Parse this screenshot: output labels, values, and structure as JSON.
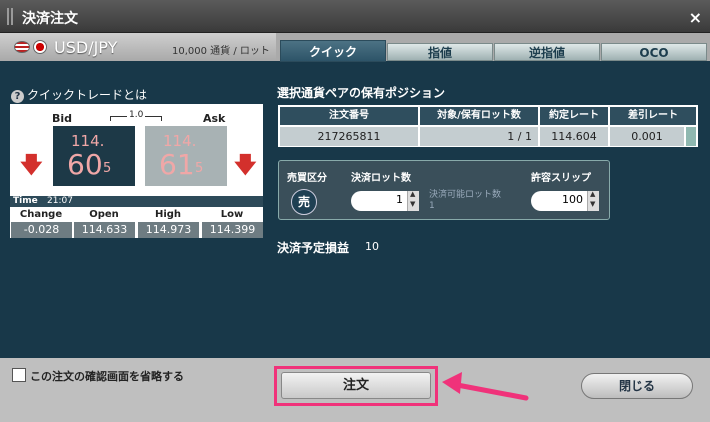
{
  "window": {
    "title": "決済注文",
    "close_glyph": "×"
  },
  "currency": {
    "pair": "USD/JPY",
    "unit": "10,000 通貨 / ロット"
  },
  "tabs": [
    {
      "label": "クイック",
      "active": true
    },
    {
      "label": "指値",
      "active": false
    },
    {
      "label": "逆指値",
      "active": false
    },
    {
      "label": "OCO",
      "active": false
    }
  ],
  "quick": {
    "help_label": "クイックトレードとは",
    "bid_label": "Bid",
    "ask_label": "Ask",
    "spread": "1.0",
    "bid": {
      "int": "114.",
      "big": "60",
      "small": "5"
    },
    "ask": {
      "int": "114.",
      "big": "61",
      "small": "5"
    },
    "time_label": "Time",
    "time_value": "21:07",
    "stats": {
      "headers": [
        "Change",
        "Open",
        "High",
        "Low"
      ],
      "values": [
        "-0.028",
        "114.633",
        "114.973",
        "114.399"
      ]
    }
  },
  "positions": {
    "title": "選択通貨ペアの保有ポジション",
    "headers": [
      "注文番号",
      "対象/保有ロット数",
      "約定レート",
      "差引レート"
    ],
    "row": [
      "217265811",
      "1 / 1",
      "114.604",
      "0.001"
    ]
  },
  "order": {
    "side_label": "売買区分",
    "side_value": "売",
    "lot_label": "決済ロット数",
    "lot_value": "1",
    "available_label": "決済可能ロット数",
    "available_value": "1",
    "slip_label": "許容スリップ",
    "slip_value": "100"
  },
  "pl": {
    "label": "決済予定損益",
    "value": "10"
  },
  "footer": {
    "skip_confirm_label": "この注文の確認画面を省略する",
    "order_button": "注文",
    "close_button": "閉じる"
  },
  "colors": {
    "accent_pink": "#f0327a",
    "panel": "#183849",
    "sell_arrow": "#d3302c"
  }
}
